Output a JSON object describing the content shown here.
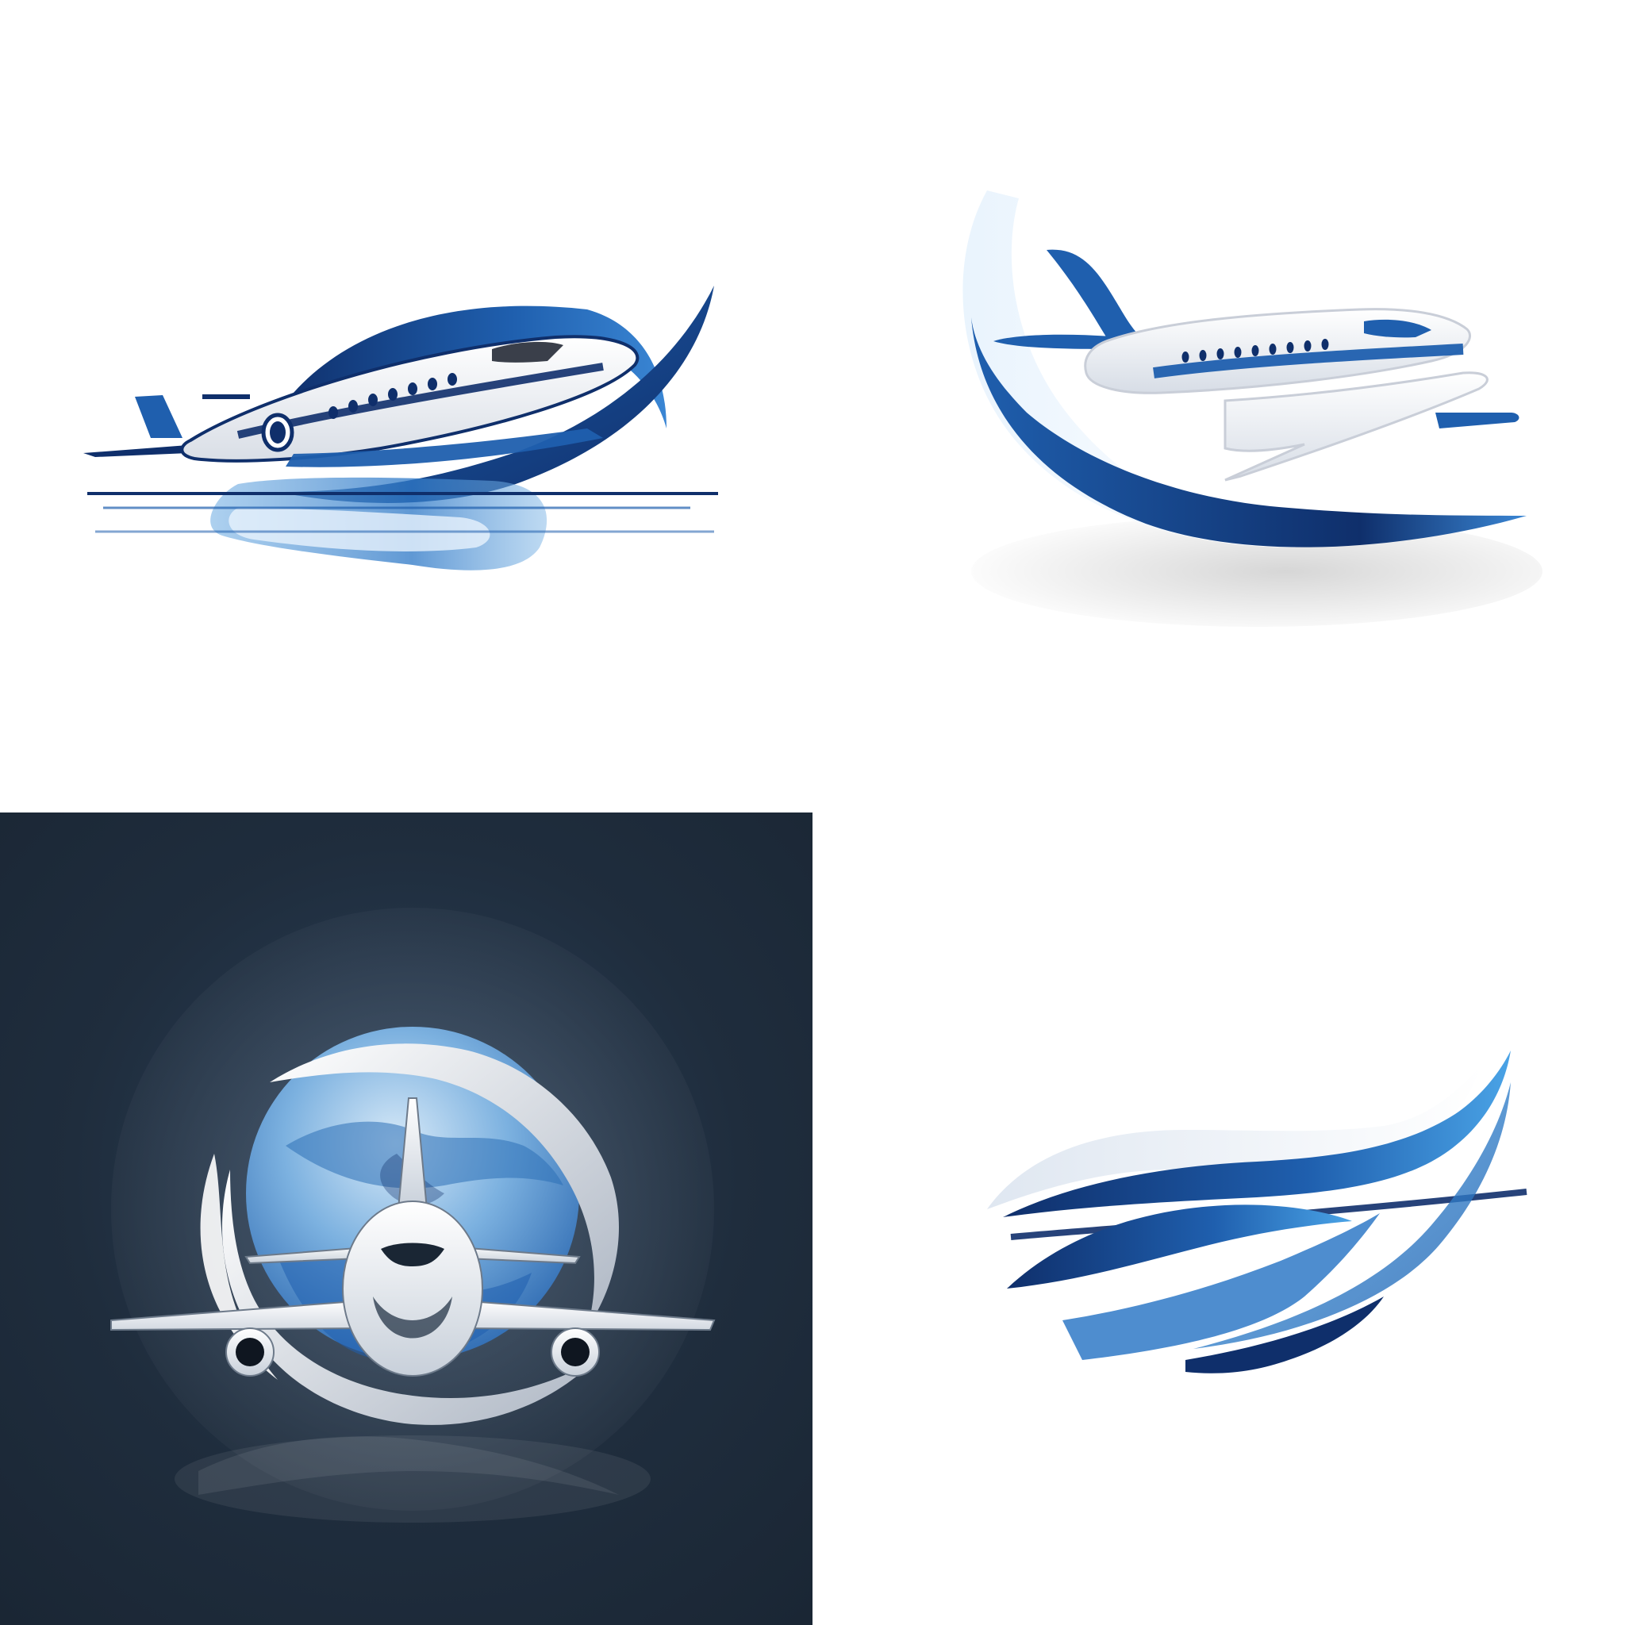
{
  "layout": {
    "columns": 2,
    "rows": 2,
    "tiles": [
      {
        "id": "tile-1",
        "background": "#ffffff",
        "motif": "airplane-with-swoosh-and-reflection"
      },
      {
        "id": "tile-2",
        "background": "#ffffff",
        "motif": "airplane-over-blue-arc"
      },
      {
        "id": "tile-3",
        "background": "#1f2d3d",
        "motif": "airplane-front-view-over-globe"
      },
      {
        "id": "tile-4",
        "background": "#ffffff",
        "motif": "abstract-blue-swooshes"
      }
    ]
  },
  "colors": {
    "primary_blue": "#1f5fae",
    "dark_blue": "#0f2f6b",
    "light_blue": "#4aa3e6",
    "pale_blue": "#c9e3f6",
    "white": "#ffffff",
    "silver": "#d7dde6",
    "dark_background": "#1f2d3d"
  },
  "icons": [
    "airplane-icon",
    "swoosh-icon",
    "globe-icon"
  ]
}
